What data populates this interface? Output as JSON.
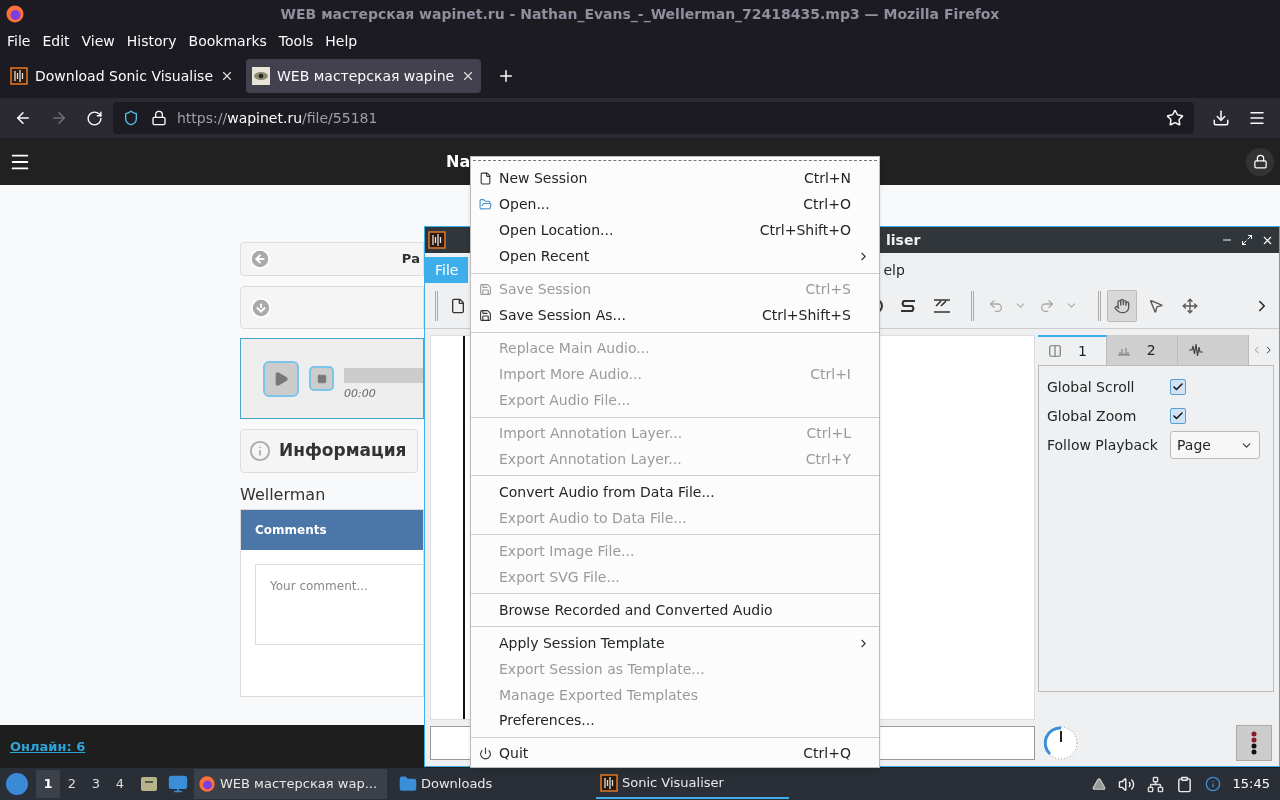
{
  "browser": {
    "title": "WEB мастерская wapinet.ru - Nathan_Evans_-_Wellerman_72418435.mp3 — Mozilla Firefox",
    "menu": [
      "File",
      "Edit",
      "View",
      "History",
      "Bookmarks",
      "Tools",
      "Help"
    ],
    "tabs": [
      {
        "label": "Download Sonic Visualise",
        "selected": false
      },
      {
        "label": "WEB мастерская wapine",
        "selected": true
      }
    ],
    "url": {
      "scheme": "https://",
      "host": "wapinet.ru",
      "path": "/file/55181"
    }
  },
  "page": {
    "header_title": "Na",
    "back_label": "Ра",
    "player_time": "00:00",
    "info_title": "Информация",
    "file_name": "Wellerman",
    "comments_title": "Comments",
    "comment_placeholder": "Your comment...",
    "online": "Онлайн: 6"
  },
  "sonic_visualiser": {
    "title": "liser",
    "menu": [
      {
        "label": "File",
        "selected": true
      },
      {
        "label": "elp",
        "selected": false
      }
    ],
    "tools": [
      {
        "selected": true
      },
      {
        "selected": false
      },
      {
        "selected": false
      }
    ],
    "panel_tabs": [
      {
        "label": "1",
        "selected": true
      },
      {
        "label": "2",
        "selected": false
      },
      {
        "selected": false
      }
    ],
    "options": [
      {
        "kind": "checkbox",
        "label": "Global Scroll",
        "checked": true
      },
      {
        "kind": "checkbox",
        "label": "Global Zoom",
        "checked": true
      },
      {
        "kind": "select",
        "label": "Follow Playback",
        "value": "Page"
      }
    ]
  },
  "file_menu": [
    {
      "kind": "item",
      "label": "New Session",
      "shortcut": "Ctrl+N",
      "disabled": false,
      "submenu": false
    },
    {
      "kind": "item",
      "label": "Open...",
      "shortcut": "Ctrl+O",
      "disabled": false,
      "submenu": false
    },
    {
      "kind": "item",
      "label": "Open Location...",
      "shortcut": "Ctrl+Shift+O",
      "disabled": false,
      "submenu": false
    },
    {
      "kind": "item",
      "label": "Open Recent",
      "disabled": false,
      "submenu": true
    },
    {
      "kind": "separator"
    },
    {
      "kind": "item",
      "label": "Save Session",
      "shortcut": "Ctrl+S",
      "disabled": true,
      "submenu": false
    },
    {
      "kind": "item",
      "label": "Save Session As...",
      "shortcut": "Ctrl+Shift+S",
      "disabled": false,
      "submenu": false
    },
    {
      "kind": "separator"
    },
    {
      "kind": "item",
      "label": "Replace Main Audio...",
      "disabled": true,
      "submenu": false
    },
    {
      "kind": "item",
      "label": "Import More Audio...",
      "shortcut": "Ctrl+I",
      "disabled": true,
      "submenu": false
    },
    {
      "kind": "item",
      "label": "Export Audio File...",
      "disabled": true,
      "submenu": false
    },
    {
      "kind": "separator"
    },
    {
      "kind": "item",
      "label": "Import Annotation Layer...",
      "shortcut": "Ctrl+L",
      "disabled": true,
      "submenu": false
    },
    {
      "kind": "item",
      "label": "Export Annotation Layer...",
      "shortcut": "Ctrl+Y",
      "disabled": true,
      "submenu": false
    },
    {
      "kind": "separator"
    },
    {
      "kind": "item",
      "label": "Convert Audio from Data File...",
      "disabled": false,
      "submenu": false
    },
    {
      "kind": "item",
      "label": "Export Audio to Data File...",
      "disabled": true,
      "submenu": false
    },
    {
      "kind": "separator"
    },
    {
      "kind": "item",
      "label": "Export Image File...",
      "disabled": true,
      "submenu": false
    },
    {
      "kind": "item",
      "label": "Export SVG File...",
      "disabled": true,
      "submenu": false
    },
    {
      "kind": "separator"
    },
    {
      "kind": "item",
      "label": "Browse Recorded and Converted Audio",
      "disabled": false,
      "submenu": false
    },
    {
      "kind": "separator"
    },
    {
      "kind": "item",
      "label": "Apply Session Template",
      "disabled": false,
      "submenu": true
    },
    {
      "kind": "item",
      "label": "Export Session as Template...",
      "disabled": true,
      "submenu": false
    },
    {
      "kind": "item",
      "label": "Manage Exported Templates",
      "disabled": true,
      "submenu": false
    },
    {
      "kind": "item",
      "label": "Preferences...",
      "disabled": false,
      "submenu": false
    },
    {
      "kind": "separator"
    },
    {
      "kind": "item",
      "label": "Quit",
      "shortcut": "Ctrl+Q",
      "disabled": false,
      "submenu": false
    }
  ],
  "taskbar": {
    "workspaces": [
      {
        "label": "1",
        "selected": true
      },
      {
        "label": "2",
        "selected": false
      },
      {
        "label": "3",
        "selected": false
      },
      {
        "label": "4",
        "selected": false
      }
    ],
    "tasks": [
      {
        "label": "WEB мастерская wap...",
        "selected": false
      },
      {
        "label": "Downloads",
        "selected": false
      },
      {
        "label": "Sonic Visualiser",
        "selected": true
      }
    ],
    "clock": "15:45"
  }
}
